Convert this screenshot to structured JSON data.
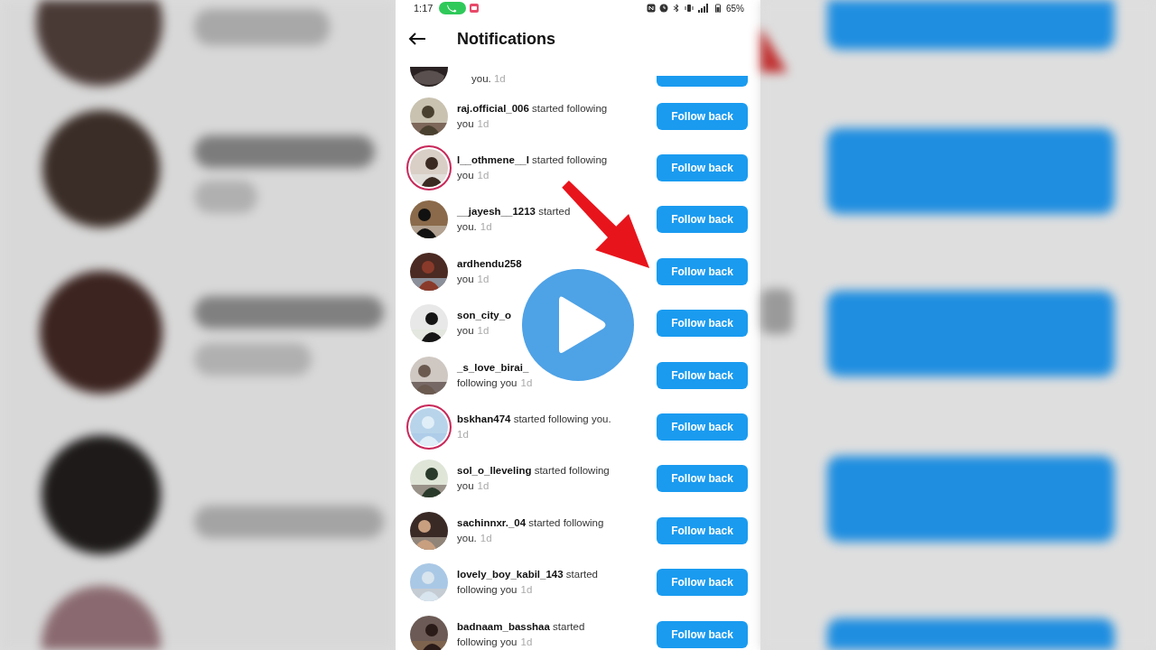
{
  "status_bar": {
    "time": "1:17",
    "battery": "65%"
  },
  "header": {
    "title": "Notifications"
  },
  "notifications": [
    {
      "kind": "partial",
      "line2": "you.",
      "time": "1d"
    },
    {
      "kind": "follow",
      "username": "raj.official_006",
      "action": "started following",
      "line2": "you",
      "time": "1d",
      "story_ring": false,
      "button": "Follow back"
    },
    {
      "kind": "follow",
      "username": "l__othmene__l",
      "action": "started following",
      "line2": "you",
      "time": "1d",
      "story_ring": true,
      "button": "Follow back"
    },
    {
      "kind": "follow",
      "username": "__jayesh__1213",
      "action": "started",
      "line2": "you.",
      "time": "1d",
      "story_ring": false,
      "button": "Follow back"
    },
    {
      "kind": "follow",
      "username": "ardhendu258",
      "line2": "you",
      "time": "1d",
      "story_ring": false,
      "button": "Follow back"
    },
    {
      "kind": "follow",
      "username": "son_city_o",
      "line2": "you",
      "time": "1d",
      "story_ring": false,
      "button": "Follow back"
    },
    {
      "kind": "follow",
      "username": "_s_love_birai_",
      "line2": "following you",
      "time": "1d",
      "story_ring": false,
      "button": "Follow back"
    },
    {
      "kind": "follow",
      "username": "bskhan474",
      "action": "started following you.",
      "time": "1d",
      "story_ring": true,
      "button": "Follow back"
    },
    {
      "kind": "follow",
      "username": "sol_o_lleveling",
      "action": "started following",
      "line2": "you",
      "time": "1d",
      "story_ring": false,
      "button": "Follow back"
    },
    {
      "kind": "follow",
      "username": "sachinnxr._04",
      "action": "started following",
      "line2": "you.",
      "time": "1d",
      "story_ring": false,
      "button": "Follow back"
    },
    {
      "kind": "follow",
      "username": "lovely_boy_kabil_143",
      "action": "started",
      "line2": "following you",
      "time": "1d",
      "story_ring": false,
      "button": "Follow back"
    },
    {
      "kind": "follow",
      "username": "badnaam_basshaa",
      "action": "started",
      "line2": "following you",
      "time": "1d",
      "story_ring": false,
      "button": "Follow back"
    }
  ]
}
